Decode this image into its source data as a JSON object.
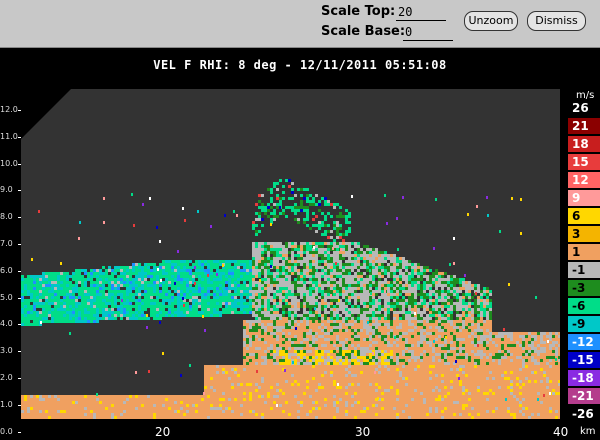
{
  "toolbar": {
    "scale_top_label": "Scale Top:",
    "scale_top_value": "20",
    "scale_base_label": "Scale Base:",
    "scale_base_value": "0",
    "unzoom_label": "Unzoom",
    "dismiss_label": "Dismiss"
  },
  "title": "VEL F  RHI: 8 deg  -  12/11/2011 05:51:08",
  "axes": {
    "y_ticks": [
      "12.0",
      "11.0",
      "10.0",
      "9.0",
      "8.0",
      "7.0",
      "6.0",
      "5.0",
      "4.0",
      "3.0",
      "2.0",
      "1.0",
      "0.0"
    ],
    "x_ticks": [
      "20",
      "30",
      "40"
    ],
    "x_unit": "km"
  },
  "legend": {
    "unit": "m/s",
    "entries": [
      {
        "label": "26",
        "color": "#000000",
        "text": "#ffffff"
      },
      {
        "label": "21",
        "color": "#8b0000",
        "text": "#ffffff"
      },
      {
        "label": "18",
        "color": "#c81e1e",
        "text": "#ffffff"
      },
      {
        "label": "15",
        "color": "#e83c3c",
        "text": "#ffffff"
      },
      {
        "label": "12",
        "color": "#ff6464",
        "text": "#ffffff"
      },
      {
        "label": "9",
        "color": "#ff9a9a",
        "text": "#ffffff"
      },
      {
        "label": "6",
        "color": "#ffd700",
        "text": "#000000"
      },
      {
        "label": "3",
        "color": "#f4b400",
        "text": "#000000"
      },
      {
        "label": "1",
        "color": "#f0a060",
        "text": "#000000"
      },
      {
        "label": "-1",
        "color": "#b8b8b8",
        "text": "#000000"
      },
      {
        "label": "-3",
        "color": "#1e8c1e",
        "text": "#000000"
      },
      {
        "label": "-6",
        "color": "#00dd88",
        "text": "#000000"
      },
      {
        "label": "-9",
        "color": "#00c8c8",
        "text": "#000000"
      },
      {
        "label": "-12",
        "color": "#1e90ff",
        "text": "#ffffff"
      },
      {
        "label": "-15",
        "color": "#0000c8",
        "text": "#ffffff"
      },
      {
        "label": "-18",
        "color": "#8a2be2",
        "text": "#ffffff"
      },
      {
        "label": "-21",
        "color": "#b43c8c",
        "text": "#ffffff"
      },
      {
        "label": "-26",
        "color": "#000000",
        "text": "#ffffff"
      }
    ]
  }
}
